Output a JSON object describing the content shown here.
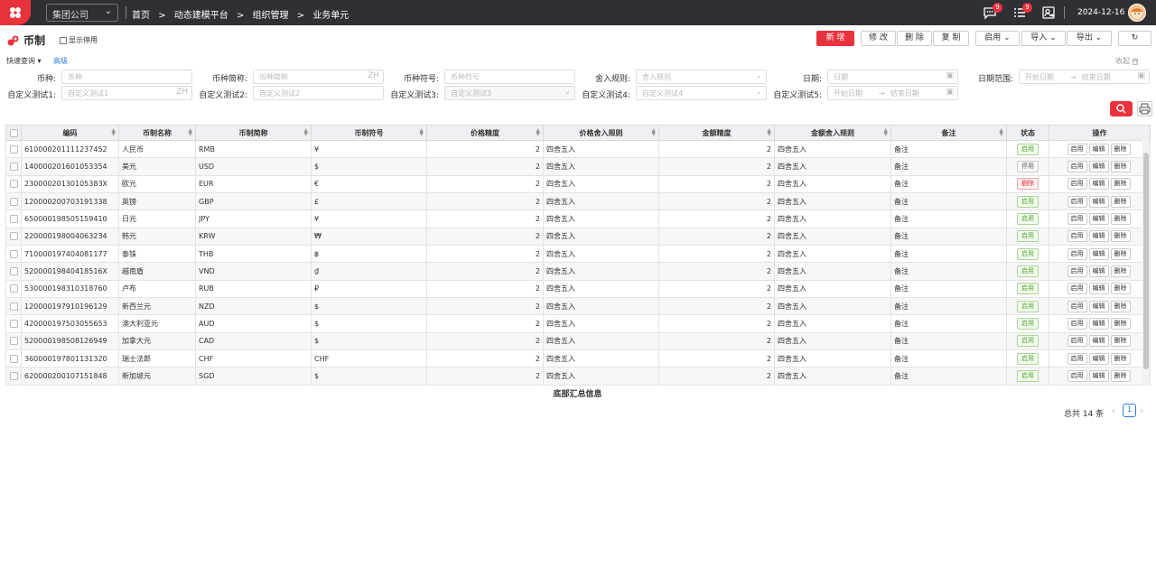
{
  "topbar": {
    "company": "集团公司",
    "breadcrumb": [
      "首页",
      ">",
      "动态建模平台",
      ">",
      "组织管理",
      ">",
      "业务单元"
    ],
    "msg_badge": "9",
    "task_badge": "9",
    "date": "2024-12-16"
  },
  "page": {
    "title": "币制",
    "show_disabled": "显示停用",
    "quick_search": "快速查询",
    "advanced": "高级",
    "collapse": "收起"
  },
  "toolbar": {
    "new": "新 增",
    "edit": "修 改",
    "delete": "删 除",
    "copy": "复 制",
    "enable": "启用",
    "import": "导入",
    "export": "导出"
  },
  "filters": {
    "currency_label": "币种:",
    "currency_ph": "币种",
    "abbr_label": "币种简称:",
    "abbr_ph": "币种简称",
    "abbr_suffix": "ZH",
    "symbol_label": "币种符号:",
    "symbol_ph": "币种符号",
    "round_label": "舍入规则:",
    "round_ph": "舍入规则",
    "date_label": "日期:",
    "date_ph": "日期",
    "range_label": "日期范围:",
    "range_start": "开始日期",
    "range_end": "结束日期",
    "c1_label": "自定义测试1:",
    "c1_ph": "自定义测试1",
    "c1_suffix": "ZH",
    "c2_label": "自定义测试2:",
    "c2_ph": "自定义测试2",
    "c3_label": "自定义测试3:",
    "c3_ph": "自定义测试3",
    "c4_label": "自定义测试4:",
    "c4_ph": "自定义测试4",
    "c5_label": "自定义测试5:",
    "c5_start": "开始日期",
    "c5_end": "结束日期"
  },
  "table": {
    "headers": [
      "编码",
      "币制名称",
      "币制简称",
      "币制符号",
      "价格精度",
      "价格舍入规则",
      "金额精度",
      "金额舍入规则",
      "备注",
      "状态",
      "操作"
    ],
    "rows": [
      [
        "610000201111237452",
        "人民币",
        "RMB",
        "¥",
        "2",
        "四舍五入",
        "2",
        "四舍五入",
        "备注",
        "启用"
      ],
      [
        "140000201601053354",
        "美元",
        "USD",
        "$",
        "2",
        "四舍五入",
        "2",
        "四舍五入",
        "备注",
        "停用"
      ],
      [
        "23000020130105383X",
        "欧元",
        "EUR",
        "€",
        "2",
        "四舍五入",
        "2",
        "四舍五入",
        "备注",
        "删除"
      ],
      [
        "120000200703191338",
        "英镑",
        "GBP",
        "£",
        "2",
        "四舍五入",
        "2",
        "四舍五入",
        "备注",
        "启用"
      ],
      [
        "650000198505159410",
        "日元",
        "JPY",
        "¥",
        "2",
        "四舍五入",
        "2",
        "四舍五入",
        "备注",
        "启用"
      ],
      [
        "220000198004063234",
        "韩元",
        "KRW",
        "₩",
        "2",
        "四舍五入",
        "2",
        "四舍五入",
        "备注",
        "启用"
      ],
      [
        "710000197404081177",
        "泰铢",
        "THB",
        "฿",
        "2",
        "四舍五入",
        "2",
        "四舍五入",
        "备注",
        "启用"
      ],
      [
        "52000019840418516X",
        "越南盾",
        "VND",
        "₫",
        "2",
        "四舍五入",
        "2",
        "四舍五入",
        "备注",
        "启用"
      ],
      [
        "530000198310318760",
        "卢布",
        "RUB",
        "₽",
        "2",
        "四舍五入",
        "2",
        "四舍五入",
        "备注",
        "启用"
      ],
      [
        "120000197910196129",
        "新西兰元",
        "NZD",
        "$",
        "2",
        "四舍五入",
        "2",
        "四舍五入",
        "备注",
        "启用"
      ],
      [
        "420000197503055653",
        "澳大利亚元",
        "AUD",
        "$",
        "2",
        "四舍五入",
        "2",
        "四舍五入",
        "备注",
        "启用"
      ],
      [
        "520000198508126949",
        "加拿大元",
        "CAD",
        "$",
        "2",
        "四舍五入",
        "2",
        "四舍五入",
        "备注",
        "启用"
      ],
      [
        "360000197801131320",
        "瑞士法郎",
        "CHF",
        "CHF",
        "2",
        "四舍五入",
        "2",
        "四舍五入",
        "备注",
        "启用"
      ],
      [
        "620000200107151848",
        "新加坡元",
        "SGD",
        "$",
        "2",
        "四舍五入",
        "2",
        "四舍五入",
        "备注",
        "启用"
      ]
    ],
    "ops": [
      "启用",
      "编辑",
      "删除"
    ],
    "footer": "底部汇总信息"
  },
  "pagination": {
    "total": "总共 14 条",
    "page": "1"
  },
  "colors": {
    "accent": "#e8323c",
    "topbar": "#2f3034",
    "link": "#2f7fd5"
  }
}
